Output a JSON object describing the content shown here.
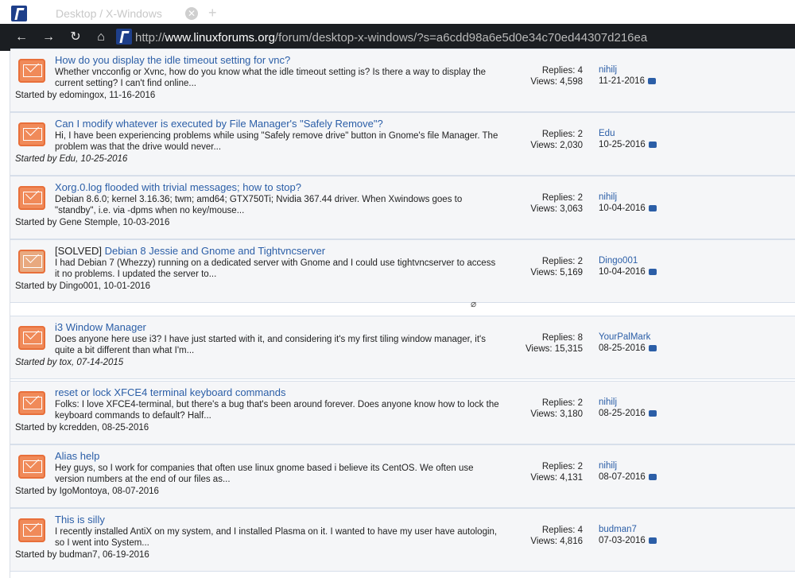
{
  "browser": {
    "tab_title": "Desktop / X-Windows",
    "close_glyph": "✕",
    "new_tab_glyph": "+",
    "url_prefix": "http://",
    "url_domain": "www.linuxforums.org",
    "url_path": "/forum/desktop-x-windows/?s=a6cdd98a6e5d0e34c70ed44307d216ea",
    "nav": {
      "back": "←",
      "forward": "→",
      "reload": "↻",
      "home": "⌂"
    }
  },
  "threads": [
    {
      "prefix": "",
      "title": "How do you display the idle timeout setting for vnc?",
      "excerpt": "Whether vncconfig or Xvnc, how do you know what the idle timeout setting is? Is there a way to display the current setting? I can't find online...",
      "started": "Started by edomingox, 11-16-2016",
      "italic": false,
      "replies": "Replies: 4",
      "views": "Views: 4,598",
      "last_user": "nihilj",
      "last_date": "11-21-2016",
      "solved": false
    },
    {
      "prefix": "",
      "title": "Can I modify whatever is executed by File Manager's \"Safely Remove\"?",
      "excerpt": "Hi, I have been experiencing problems while using \"Safely remove drive\" button in Gnome's file Manager. The problem was that the drive would never...",
      "started": "Started by Edu, 10-25-2016",
      "italic": true,
      "replies": "Replies: 2",
      "views": "Views: 2,030",
      "last_user": "Edu",
      "last_date": "10-25-2016",
      "solved": false
    },
    {
      "prefix": "",
      "title": "Xorg.0.log flooded with trivial messages; how to stop?",
      "excerpt": "Debian 8.6.0; kernel 3.16.36; twm; amd64; GTX750Ti; Nvidia 367.44 driver. When Xwindows goes to \"standby\", i.e. via -dpms when no key/mouse...",
      "started": "Started by Gene Stemple, 10-03-2016",
      "italic": false,
      "replies": "Replies: 2",
      "views": "Views: 3,063",
      "last_user": "nihilj",
      "last_date": "10-04-2016",
      "solved": false
    },
    {
      "prefix": "[SOLVED] ",
      "title": "Debian 8 Jessie and Gnome and Tightvncserver",
      "excerpt": "I had Debian 7 (Whezzy) running on a dedicated server with Gnome and I could use tightvncserver to access it no problems. I updated the server to...",
      "started": "Started by Dingo001, 10-01-2016",
      "italic": false,
      "replies": "Replies: 2",
      "views": "Views: 5,169",
      "last_user": "Dingo001",
      "last_date": "10-04-2016",
      "solved": true
    },
    {
      "prefix": "",
      "title": "i3 Window Manager",
      "excerpt": "Does anyone here use i3? I have just started with it, and considering it's my first tiling window manager, it's quite a bit different than what I'm...",
      "started": "Started by tox, 07-14-2015",
      "italic": true,
      "replies": "Replies: 8",
      "views": "Views: 15,315",
      "last_user": "YourPalMark",
      "last_date": "08-25-2016",
      "solved": false
    },
    {
      "prefix": "",
      "title": "reset or lock XFCE4 terminal keyboard commands",
      "excerpt": "Folks: I love XFCE4-terminal, but there's a bug that's been around forever. Does anyone know how to lock the keyboard commands to default? Half...",
      "started": "Started by kcredden, 08-25-2016",
      "italic": false,
      "replies": "Replies: 2",
      "views": "Views: 3,180",
      "last_user": "nihilj",
      "last_date": "08-25-2016",
      "solved": false
    },
    {
      "prefix": "",
      "title": "Alias help",
      "excerpt": "Hey guys, so I work for companies that often use linux gnome based i believe its CentOS. We often use version numbers at the end of our files as...",
      "started": "Started by IgoMontoya, 08-07-2016",
      "italic": false,
      "replies": "Replies: 2",
      "views": "Views: 4,131",
      "last_user": "nihilj",
      "last_date": "08-07-2016",
      "solved": false
    },
    {
      "prefix": "",
      "title": "This is silly",
      "excerpt": "I recently installed AntiX on my system, and I installed Plasma on it. I wanted to have my user have autologin, so I went into System...",
      "started": "Started by budman7, 06-19-2016",
      "italic": false,
      "replies": "Replies: 4",
      "views": "Views: 4,816",
      "last_user": "budman7",
      "last_date": "07-03-2016",
      "solved": false
    }
  ]
}
